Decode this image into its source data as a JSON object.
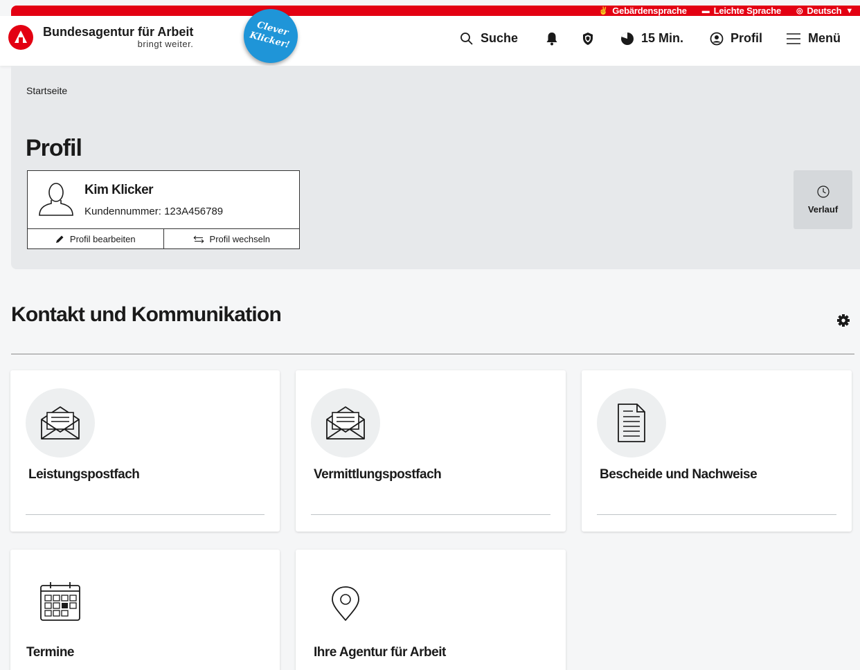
{
  "topbar": {
    "sign_language": "Gebärdensprache",
    "easy_language": "Leichte Sprache",
    "language": "Deutsch"
  },
  "header": {
    "logo_title": "Bundesagentur für Arbeit",
    "logo_slogan": "bringt weiter.",
    "badge_line1": "Clever",
    "badge_line2": "Klicker!",
    "search_label": "Suche",
    "timer_label": "15 Min.",
    "profile_label": "Profil",
    "menu_label": "Menü"
  },
  "profile": {
    "breadcrumb": "Startseite",
    "page_title": "Profil",
    "name": "Kim Klicker",
    "customer_number": "Kundennummer: 123A456789",
    "edit_label": "Profil bearbeiten",
    "switch_label": "Profil wechseln",
    "history_label": "Verlauf"
  },
  "section": {
    "title": "Kontakt und Kommunikation"
  },
  "tiles": [
    {
      "title": "Leistungspostfach",
      "icon": "envelope-open-icon"
    },
    {
      "title": "Vermittlungspostfach",
      "icon": "envelope-open-icon"
    },
    {
      "title": "Bescheide und Nachweise",
      "icon": "document-icon"
    },
    {
      "title": "Termine",
      "icon": "calendar-icon"
    },
    {
      "title": "Ihre Agentur für Arbeit",
      "icon": "location-pin-icon"
    }
  ],
  "colors": {
    "brand_red": "#e30012",
    "badge_blue": "#1f95d8"
  }
}
